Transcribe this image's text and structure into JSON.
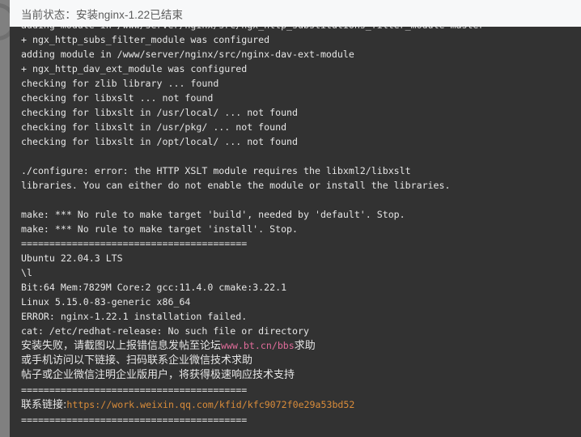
{
  "header": {
    "status_label": "当前状态：",
    "status_value": "安装nginx-1.22已结束",
    "status_full": "当前状态：安装nginx-1.22已结束"
  },
  "console": {
    "separator": "========================================",
    "lines": [
      {
        "type": "plain",
        "text": "adding module in /www/server/nginx/src/ngx_http_substitutions_filter_module-master"
      },
      {
        "type": "plain",
        "text": "+ ngx_http_subs_filter_module was configured"
      },
      {
        "type": "plain",
        "text": "adding module in /www/server/nginx/src/nginx-dav-ext-module"
      },
      {
        "type": "plain",
        "text": "+ ngx_http_dav_ext_module was configured"
      },
      {
        "type": "plain",
        "text": "checking for zlib library ... found"
      },
      {
        "type": "plain",
        "text": "checking for libxslt ... not found"
      },
      {
        "type": "plain",
        "text": "checking for libxslt in /usr/local/ ... not found"
      },
      {
        "type": "plain",
        "text": "checking for libxslt in /usr/pkg/ ... not found"
      },
      {
        "type": "plain",
        "text": "checking for libxslt in /opt/local/ ... not found"
      },
      {
        "type": "blank",
        "text": ""
      },
      {
        "type": "plain",
        "text": "./configure: error: the HTTP XSLT module requires the libxml2/libxslt"
      },
      {
        "type": "plain",
        "text": "libraries. You can either do not enable the module or install the libraries."
      },
      {
        "type": "blank",
        "text": ""
      },
      {
        "type": "plain",
        "text": "make: *** No rule to make target 'build', needed by 'default'. Stop."
      },
      {
        "type": "plain",
        "text": "make: *** No rule to make target 'install'. Stop."
      },
      {
        "type": "sep",
        "text": "========================================"
      },
      {
        "type": "plain",
        "text": "Ubuntu 22.04.3 LTS"
      },
      {
        "type": "plain",
        "text": "\\l"
      },
      {
        "type": "plain",
        "text": "Bit:64 Mem:7829M Core:2 gcc:11.4.0 cmake:3.22.1"
      },
      {
        "type": "plain",
        "text": "Linux 5.15.0-83-generic x86_64"
      },
      {
        "type": "plain",
        "text": "ERROR: nginx-1.22.1 installation failed."
      },
      {
        "type": "plain",
        "text": "cat: /etc/redhat-release: No such file or directory"
      },
      {
        "type": "cn",
        "parts": [
          {
            "text": "安装失败，请截图以上报错信息发帖至论坛",
            "color": "white",
            "mono": false
          },
          {
            "text": "www.bt.cn/bbs",
            "color": "pink",
            "mono": true
          },
          {
            "text": "求助",
            "color": "white",
            "mono": false
          }
        ]
      },
      {
        "type": "cn",
        "parts": [
          {
            "text": "或手机访问以下链接、扫码联系企业微信技术求助",
            "color": "white",
            "mono": false
          }
        ]
      },
      {
        "type": "cn",
        "parts": [
          {
            "text": "帖子或企业微信注明企业版用户，将获得极速响应技术支持",
            "color": "white",
            "mono": false
          }
        ]
      },
      {
        "type": "sep",
        "text": "========================================"
      },
      {
        "type": "cn",
        "parts": [
          {
            "text": "联系链接:",
            "color": "white",
            "mono": false
          },
          {
            "text": "https://work.weixin.qq.com/kfid/kfc9072f0e29a53bd52",
            "color": "orange",
            "mono": true
          }
        ]
      },
      {
        "type": "sep",
        "text": "========================================"
      }
    ]
  },
  "colors": {
    "console_bg": "#323232",
    "console_text": "#e6e6e6",
    "header_bg": "#f7f8f9",
    "header_text": "#5b5b5b",
    "page_bg": "#808080",
    "accent_pink": "#e06c9a",
    "accent_orange": "#d98c3a"
  }
}
